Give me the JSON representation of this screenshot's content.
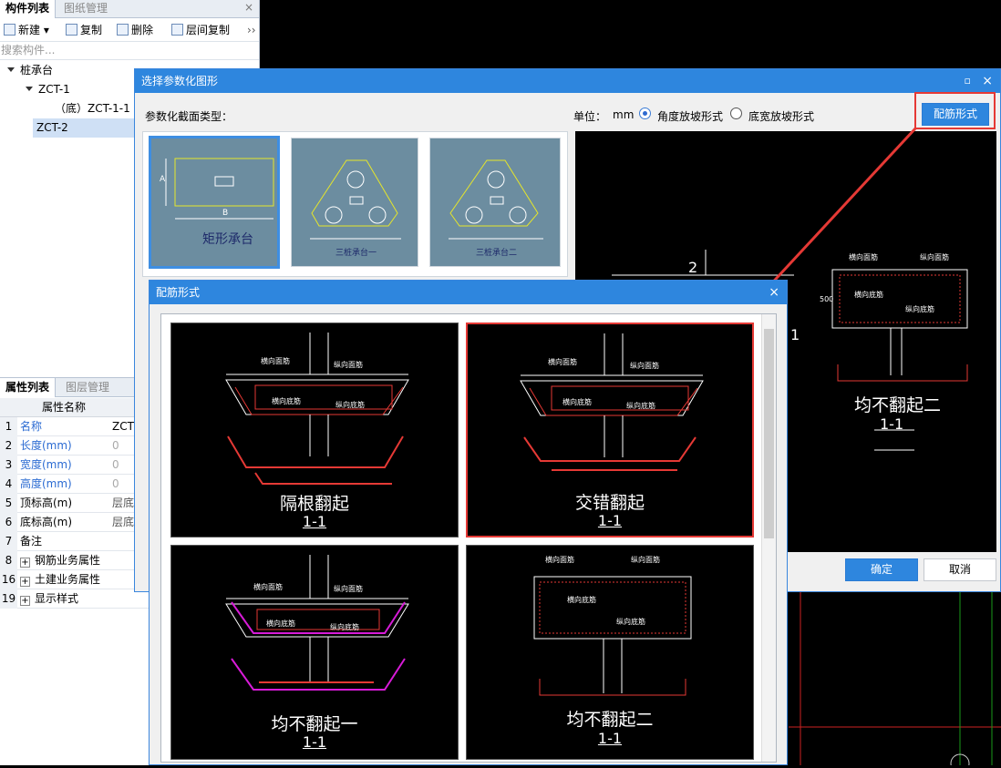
{
  "left": {
    "tabs": [
      "构件列表",
      "图纸管理"
    ],
    "close": "×",
    "toolbar": {
      "new": "新建",
      "copy": "复制",
      "delete": "删除",
      "floor_copy": "层间复制",
      "more": "››"
    },
    "search_placeholder": "搜索构件...",
    "tree": {
      "root": "桩承台",
      "child": "ZCT-1",
      "grandchild": "（底）ZCT-1-1",
      "selected": "ZCT-2"
    }
  },
  "props": {
    "tabs": [
      "属性列表",
      "图层管理"
    ],
    "header": "属性名称",
    "rows": [
      {
        "n": "1",
        "k": "名称",
        "v": "ZCT"
      },
      {
        "n": "2",
        "k": "长度(mm)",
        "v": "0"
      },
      {
        "n": "3",
        "k": "宽度(mm)",
        "v": "0"
      },
      {
        "n": "4",
        "k": "高度(mm)",
        "v": "0"
      },
      {
        "n": "5",
        "k": "顶标高(m)",
        "v": "层底"
      },
      {
        "n": "6",
        "k": "底标高(m)",
        "v": "层底"
      },
      {
        "n": "7",
        "k": "备注",
        "v": ""
      },
      {
        "n": "8",
        "k": "钢筋业务属性",
        "v": ""
      },
      {
        "n": "16",
        "k": "土建业务属性",
        "v": ""
      },
      {
        "n": "19",
        "k": "显示样式",
        "v": ""
      }
    ]
  },
  "dialog1": {
    "title": "选择参数化图形",
    "section_type_label": "参数化截面类型：",
    "unit_label": "单位：",
    "unit_value": "mm",
    "radio1": "角度放坡形式",
    "radio2": "底宽放坡形式",
    "rebar_button": "配筋形式",
    "ok": "确定",
    "cancel": "取消",
    "thumb1_label": "矩形承台",
    "thumb1_dims": [
      "A",
      "B"
    ],
    "thumb2_label": "三桩承台一",
    "thumb3_label": "三桩承台二",
    "preview": {
      "marker2": "2",
      "marker1": "1",
      "dim500": "500",
      "label": "均不翻起二",
      "section": "1-1",
      "rebars": [
        "横向面筋",
        "纵向面筋",
        "纵向底筋",
        "横向底筋"
      ]
    }
  },
  "dialog2": {
    "title": "配筋形式",
    "close": "×",
    "options": [
      {
        "label": "隔根翻起",
        "section": "1-1"
      },
      {
        "label": "交错翻起",
        "section": "1-1"
      },
      {
        "label": "均不翻起一",
        "section": "1-1"
      },
      {
        "label": "均不翻起二",
        "section": "1-1"
      }
    ],
    "rebar_labels": [
      "横向面筋",
      "纵向面筋",
      "横向底筋",
      "纵向底筋"
    ]
  },
  "colors": {
    "accent": "#2e86de",
    "highlight": "#e53935"
  }
}
